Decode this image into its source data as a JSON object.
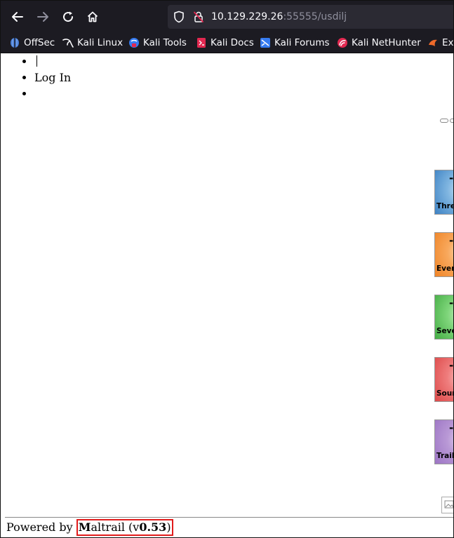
{
  "browser": {
    "url_host": "10.129.229.26",
    "url_rest": ":55555/usdilj",
    "bookmarks": [
      {
        "label": "OffSec",
        "icon": "offsec-icon"
      },
      {
        "label": "Kali Linux",
        "icon": "kali-dragon-icon"
      },
      {
        "label": "Kali Tools",
        "icon": "kali-tools-icon"
      },
      {
        "label": "Kali Docs",
        "icon": "kali-docs-icon"
      },
      {
        "label": "Kali Forums",
        "icon": "kali-forums-icon"
      },
      {
        "label": "Kali NetHunter",
        "icon": "kali-nethunter-icon"
      },
      {
        "label": "Exp",
        "icon": "exploit-db-icon"
      }
    ]
  },
  "page": {
    "menu_login": "Log In",
    "tiles": [
      {
        "value": "-",
        "label": "Threats",
        "color": "#3d82c4"
      },
      {
        "value": "-",
        "label": "Events",
        "color": "#ef8426"
      },
      {
        "value": "-",
        "label": "Severity",
        "color": "#45ad45"
      },
      {
        "value": "-",
        "label": "Sources",
        "color": "#dd4949"
      },
      {
        "value": "-",
        "label": "Trails",
        "color": "#9c74c4"
      }
    ],
    "footer": {
      "prefix": "Powered by ",
      "brand_first": "M",
      "brand_rest": "altrail",
      "version_open": " (v",
      "version": "0.53",
      "version_close": ")"
    }
  }
}
